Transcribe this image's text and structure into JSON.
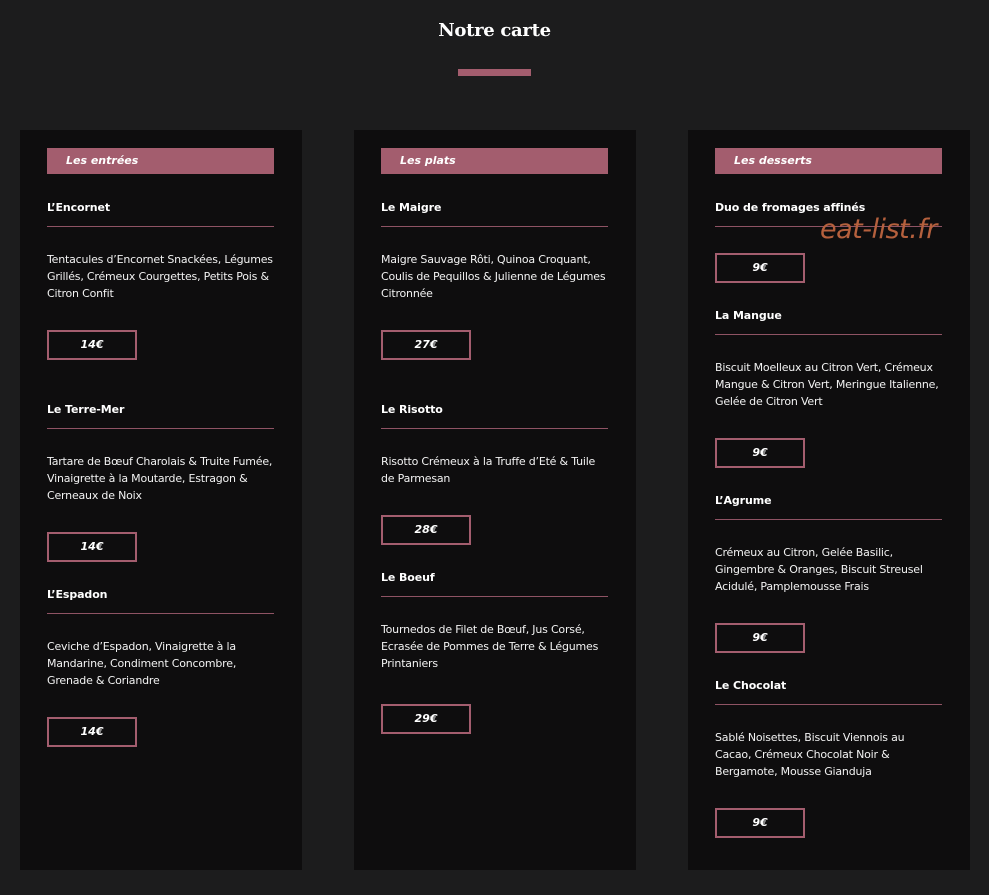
{
  "page": {
    "title": "Notre carte"
  },
  "watermark": "eat-list.fr",
  "columns": [
    {
      "heading": "Les entrées",
      "items": [
        {
          "name": "L’Encornet",
          "desc": "Tentacules d’Encornet Snackées, Légumes Grillés, Crémeux Courgettes, Petits Pois & Citron Confit",
          "price": "14€"
        },
        {
          "name": "Le Terre-Mer",
          "desc": "Tartare de Bœuf Charolais & Truite Fumée, Vinaigrette à la Moutarde, Estragon & Cerneaux de Noix",
          "price": "14€"
        },
        {
          "name": "L’Espadon",
          "desc": "Ceviche d’Espadon, Vinaigrette à la Mandarine, Condiment Concombre, Grenade & Coriandre",
          "price": "14€"
        }
      ]
    },
    {
      "heading": "Les plats",
      "items": [
        {
          "name": "Le Maigre",
          "desc": "Maigre Sauvage Rôti, Quinoa Croquant, Coulis de Pequillos & Julienne de Légumes Citronnée",
          "price": "27€"
        },
        {
          "name": "Le Risotto",
          "desc": "Risotto Crémeux à la Truffe d’Eté & Tuile de Parmesan",
          "price": "28€"
        },
        {
          "name": "Le Boeuf",
          "desc": "Tournedos de Filet de Bœuf, Jus Corsé, Ecrasée de Pommes de Terre & Légumes Printaniers",
          "price": "29€"
        }
      ]
    },
    {
      "heading": "Les desserts",
      "items": [
        {
          "name": "Duo de fromages affinés",
          "desc": "",
          "price": "9€"
        },
        {
          "name": "La Mangue",
          "desc": "Biscuit Moelleux au Citron Vert, Crémeux Mangue & Citron Vert, Meringue Italienne, Gelée de Citron Vert",
          "price": "9€"
        },
        {
          "name": "L’Agrume",
          "desc": "Crémeux au Citron, Gelée Basilic, Gingembre & Oranges,  Biscuit Streusel Acidulé, Pamplemousse Frais",
          "price": "9€"
        },
        {
          "name": "Le Chocolat",
          "desc": "Sablé Noisettes, Biscuit Viennois au Cacao, Crémeux Chocolat Noir & Bergamote, Mousse Gianduja",
          "price": "9€"
        }
      ]
    }
  ]
}
